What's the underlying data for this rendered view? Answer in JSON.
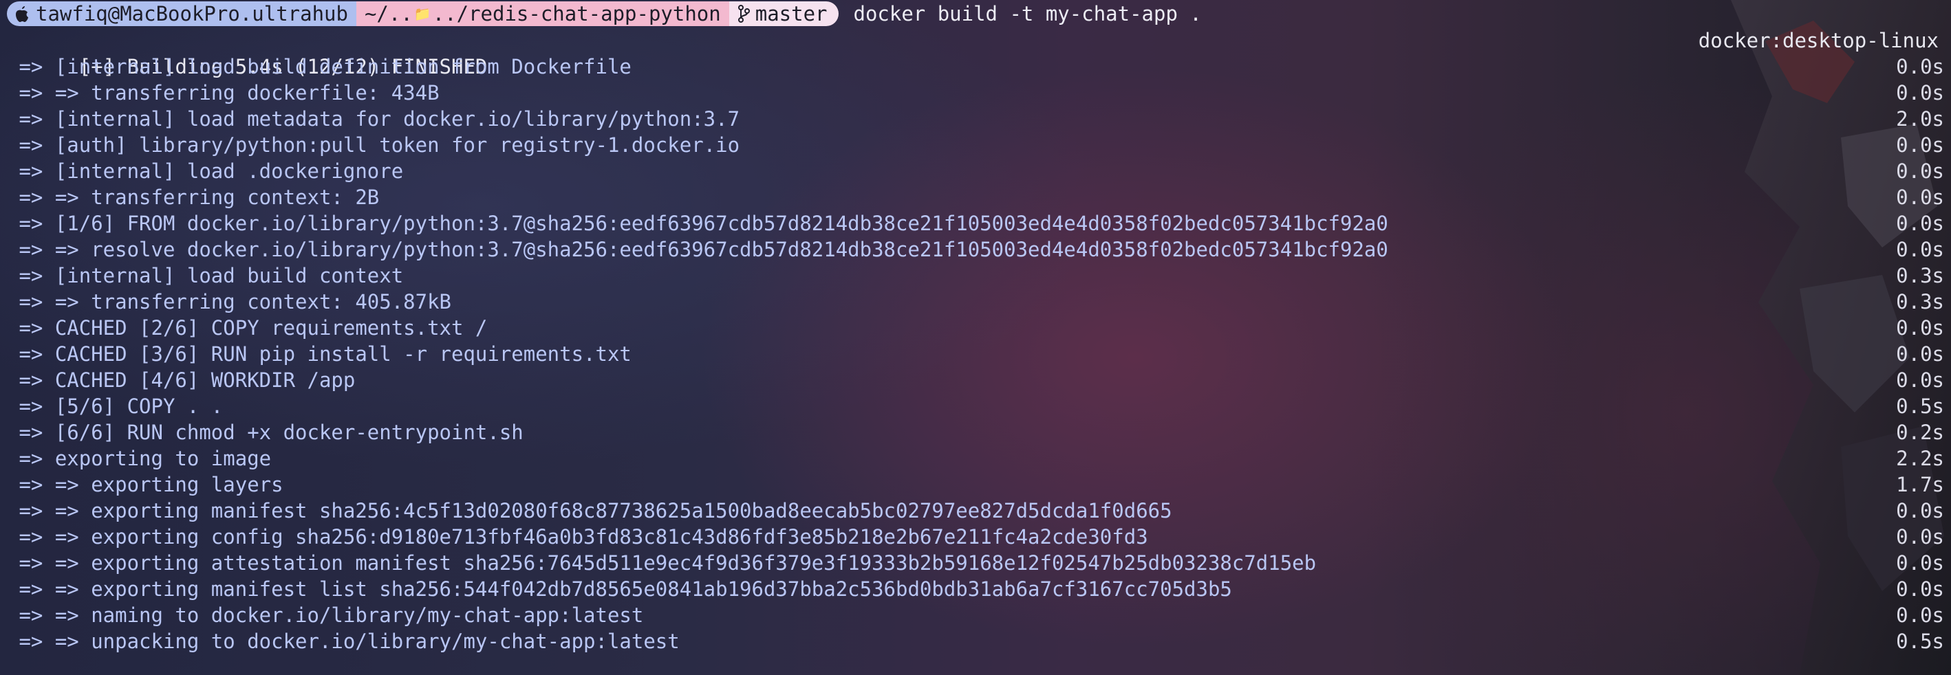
{
  "prompt": {
    "user_host": "tawfiq@MacBookPro.ultrahub",
    "path_prefix": "~/..",
    "path_suffix": "../redis-chat-app-python",
    "branch": "master",
    "command": "docker build -t my-chat-app ."
  },
  "header": {
    "text": "[+] Building 5.4s (12/12) FINISHED",
    "context": "docker:desktop-linux"
  },
  "lines": [
    {
      "text": " => [internal] load build definition from Dockerfile",
      "time": "0.0s"
    },
    {
      "text": " => => transferring dockerfile: 434B",
      "time": "0.0s"
    },
    {
      "text": " => [internal] load metadata for docker.io/library/python:3.7",
      "time": "2.0s"
    },
    {
      "text": " => [auth] library/python:pull token for registry-1.docker.io",
      "time": "0.0s"
    },
    {
      "text": " => [internal] load .dockerignore",
      "time": "0.0s"
    },
    {
      "text": " => => transferring context: 2B",
      "time": "0.0s"
    },
    {
      "text": " => [1/6] FROM docker.io/library/python:3.7@sha256:eedf63967cdb57d8214db38ce21f105003ed4e4d0358f02bedc057341bcf92a0",
      "time": "0.0s"
    },
    {
      "text": " => => resolve docker.io/library/python:3.7@sha256:eedf63967cdb57d8214db38ce21f105003ed4e4d0358f02bedc057341bcf92a0",
      "time": "0.0s"
    },
    {
      "text": " => [internal] load build context",
      "time": "0.3s"
    },
    {
      "text": " => => transferring context: 405.87kB",
      "time": "0.3s"
    },
    {
      "text": " => CACHED [2/6] COPY requirements.txt /",
      "time": "0.0s"
    },
    {
      "text": " => CACHED [3/6] RUN pip install -r requirements.txt",
      "time": "0.0s"
    },
    {
      "text": " => CACHED [4/6] WORKDIR /app",
      "time": "0.0s"
    },
    {
      "text": " => [5/6] COPY . .",
      "time": "0.5s"
    },
    {
      "text": " => [6/6] RUN chmod +x docker-entrypoint.sh",
      "time": "0.2s"
    },
    {
      "text": " => exporting to image",
      "time": "2.2s"
    },
    {
      "text": " => => exporting layers",
      "time": "1.7s"
    },
    {
      "text": " => => exporting manifest sha256:4c5f13d02080f68c87738625a1500bad8eecab5bc02797ee827d5dcda1f0d665",
      "time": "0.0s"
    },
    {
      "text": " => => exporting config sha256:d9180e713fbf46a0b3fd83c81c43d86fdf3e85b218e2b67e211fc4a2cde30fd3",
      "time": "0.0s"
    },
    {
      "text": " => => exporting attestation manifest sha256:7645d511e9ec4f9d36f379e3f19333b2b59168e12f02547b25db03238c7d15eb",
      "time": "0.0s"
    },
    {
      "text": " => => exporting manifest list sha256:544f042db7d8565e0841ab196d37bba2c536bd0bdb31ab6a7cf3167cc705d3b5",
      "time": "0.0s"
    },
    {
      "text": " => => naming to docker.io/library/my-chat-app:latest",
      "time": "0.0s"
    },
    {
      "text": " => => unpacking to docker.io/library/my-chat-app:latest",
      "time": "0.5s"
    }
  ],
  "icons": {
    "apple": "apple-icon",
    "folder": "folder-icon",
    "branch": "git-branch-icon"
  }
}
